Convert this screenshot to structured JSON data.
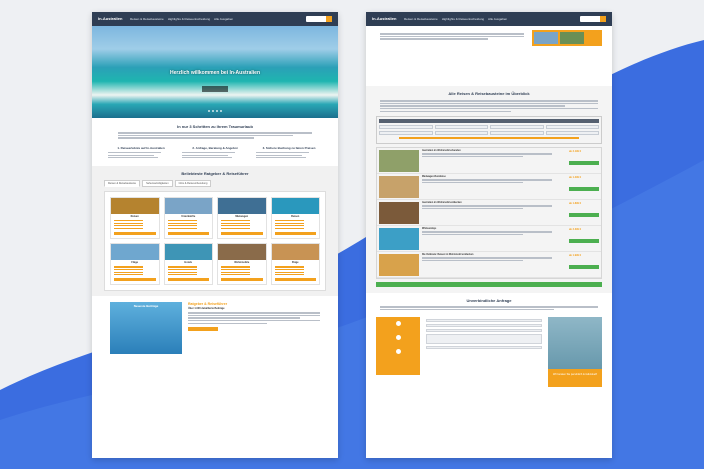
{
  "colors": {
    "accent": "#f3a11d",
    "header": "#2f3e54",
    "success": "#4caf50",
    "backdrop_blue": "#3b6de0"
  },
  "site": {
    "logo": "In-Australien",
    "nav": [
      "Reisen & Reisebausteine",
      "Highlights & Reiseentscheidung",
      "Alle Ausgaben"
    ],
    "search_icon": "search-icon"
  },
  "left_page": {
    "hero": {
      "title": "Herzlich willkommen bei In-Australien",
      "subtitle": "",
      "button": ""
    },
    "steps_title": "In nur 3 Schritten zu Ihrem Traumurlaub",
    "steps": [
      {
        "title": "1. Reiseerlebnis auf In-Australien"
      },
      {
        "title": "2. Anfrage, Beratung & Angebot"
      },
      {
        "title": "3. Sichere Buchung zu fairen Preisen"
      }
    ],
    "guides_title": "Beliebteste Ratgeber & Reiseführer",
    "tabs": [
      "Reisen & Reisebausteine",
      "Sehenswürdigkeiten",
      "Infos & Reisevorbereitung"
    ],
    "cards": [
      {
        "title": "Reisen",
        "img": "#b5832f"
      },
      {
        "title": "Unterkünfte",
        "img": "#7aa4c7"
      },
      {
        "title": "Mietwagen",
        "img": "#3f6f94"
      },
      {
        "title": "Reisen",
        "img": "#2a98bd"
      },
      {
        "title": "Flüge",
        "img": "#6fa7cf"
      },
      {
        "title": "Hotels",
        "img": "#3e95b6"
      },
      {
        "title": "Wohnmobile",
        "img": "#8a6b4a"
      },
      {
        "title": "Flüge",
        "img": "#c89354"
      }
    ],
    "promo": {
      "image_label": "Neueste Beiträge",
      "title": "Ratgeber & Reiseführer",
      "subtitle": "Über 1.000 detaillierte Beiträge"
    }
  },
  "right_page": {
    "list_title": "Alle Reisen & Reisebausteine im Überblick",
    "results": [
      {
        "title": "Australien im Wohnmobil erkunden",
        "price": "ab 2.199 €",
        "img": "#8fa069"
      },
      {
        "title": "Mietwagen-Rundreise",
        "price": "ab 1.299 €",
        "img": "#c7a26a"
      },
      {
        "title": "Australien im Wohnmobil entdecken",
        "price": "ab 1.899 €",
        "img": "#7b5a3a"
      },
      {
        "title": "Whitsundays",
        "price": "ab 2.399 €",
        "img": "#3c9fc6"
      },
      {
        "title": "Die Ostküste: Reisen im Wohnmobil entdecken",
        "price": "ab 1.999 €",
        "img": "#d8a24b"
      }
    ],
    "contact_title": "Unverbindliche Anfrage",
    "contact_cta": "Wir beraten Sie persönlich & individuell!"
  }
}
